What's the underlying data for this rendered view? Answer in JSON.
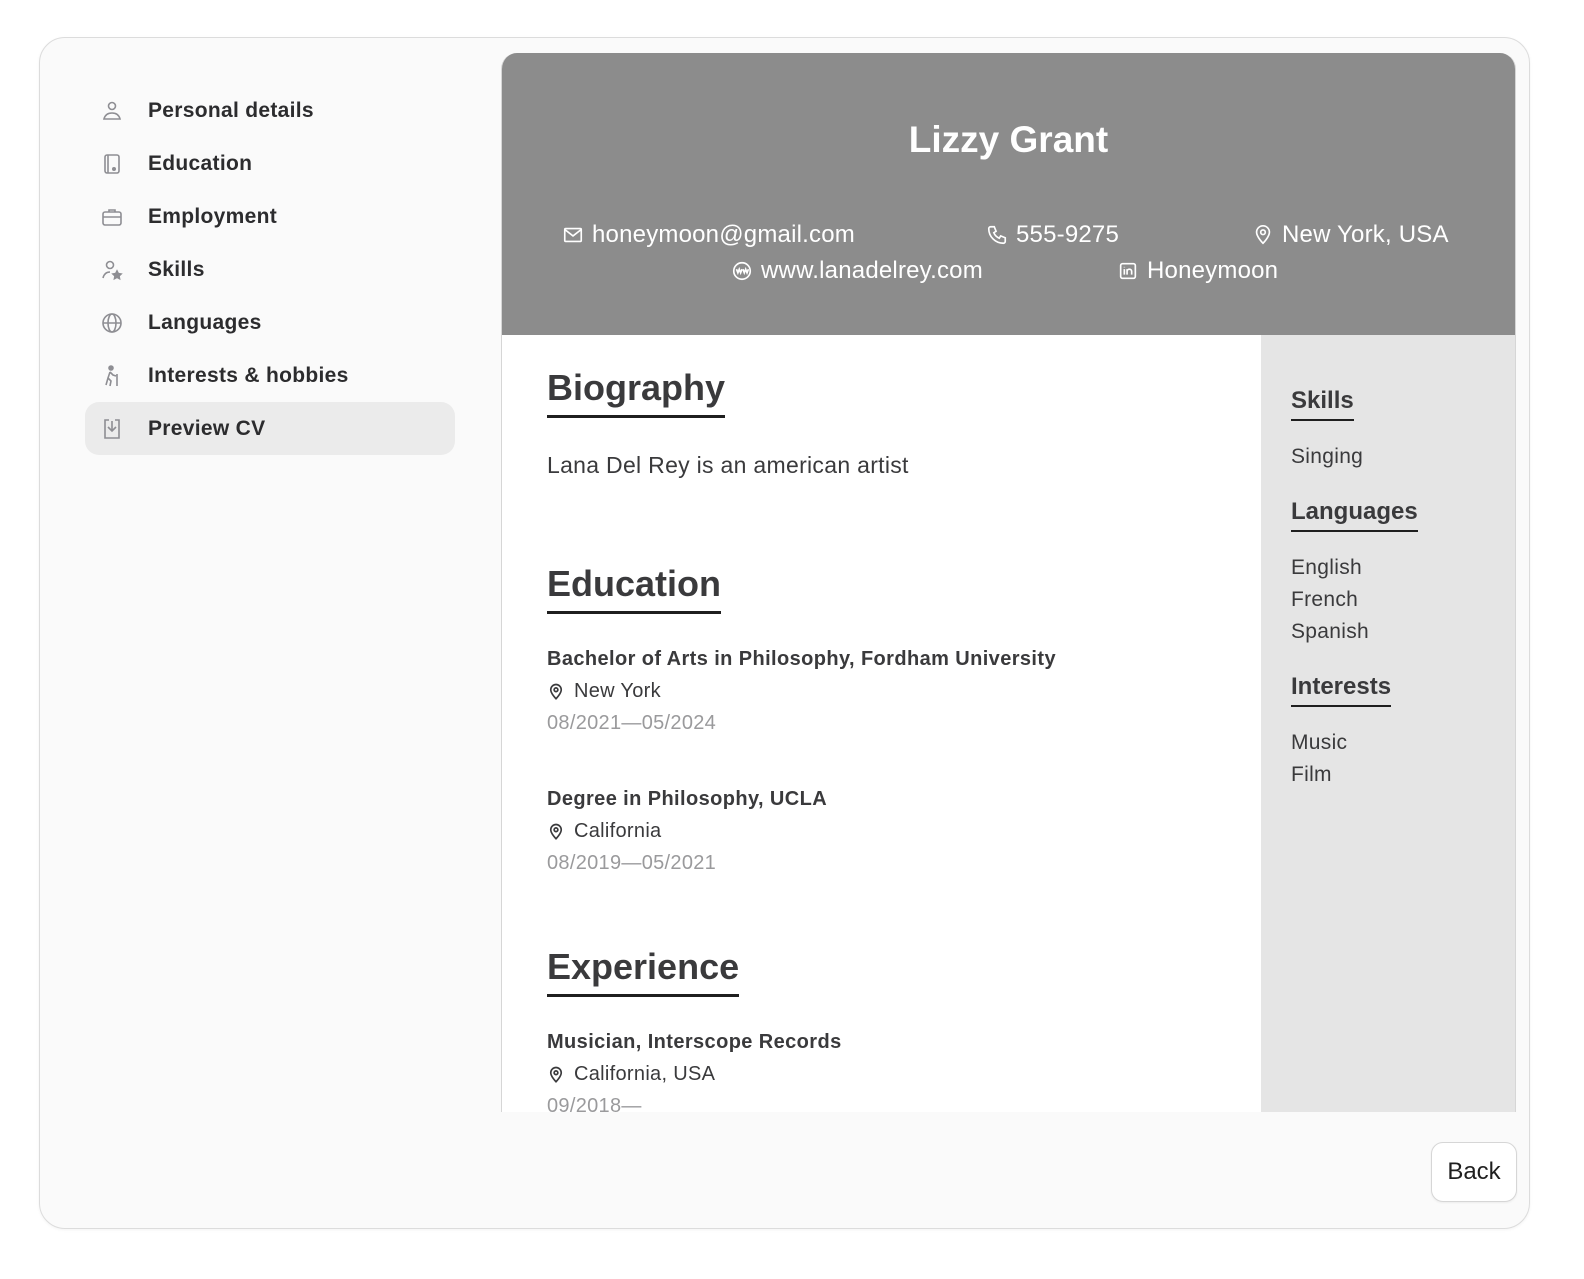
{
  "sidebar": {
    "items": [
      {
        "label": "Personal details",
        "icon": "person-icon"
      },
      {
        "label": "Education",
        "icon": "book-icon"
      },
      {
        "label": "Employment",
        "icon": "briefcase-icon"
      },
      {
        "label": "Skills",
        "icon": "person-star-icon"
      },
      {
        "label": "Languages",
        "icon": "globe-icon"
      },
      {
        "label": "Interests & hobbies",
        "icon": "hiking-icon"
      },
      {
        "label": "Preview CV",
        "icon": "download-icon",
        "active": true
      }
    ]
  },
  "cv": {
    "name": "Lizzy Grant",
    "contact": {
      "email": "honeymoon@gmail.com",
      "phone": "555-9275",
      "location": "New York, USA",
      "website": "www.lanadelrey.com",
      "linkedin": "Honeymoon"
    },
    "biography": {
      "title": "Biography",
      "text": "Lana Del Rey is an american artist"
    },
    "education": {
      "title": "Education",
      "entries": [
        {
          "title": "Bachelor of Arts in Philosophy, Fordham University",
          "location": "New York",
          "dates": "08/2021—05/2024"
        },
        {
          "title": "Degree in Philosophy, UCLA",
          "location": "California",
          "dates": "08/2019—05/2021"
        }
      ]
    },
    "experience": {
      "title": "Experience",
      "entries": [
        {
          "title": "Musician, Interscope Records",
          "location": "California, USA",
          "dates": "09/2018—"
        }
      ]
    },
    "side": {
      "skills": {
        "title": "Skills",
        "items": [
          "Singing"
        ]
      },
      "languages": {
        "title": "Languages",
        "items": [
          "English",
          "French",
          "Spanish"
        ]
      },
      "interests": {
        "title": "Interests",
        "items": [
          "Music",
          "Film"
        ]
      }
    }
  },
  "buttons": {
    "back": "Back"
  },
  "colors": {
    "header_bg": "#8c8c8c",
    "sidebar_panel_bg": "#e5e5e5",
    "active_nav_bg": "#ebebeb"
  }
}
